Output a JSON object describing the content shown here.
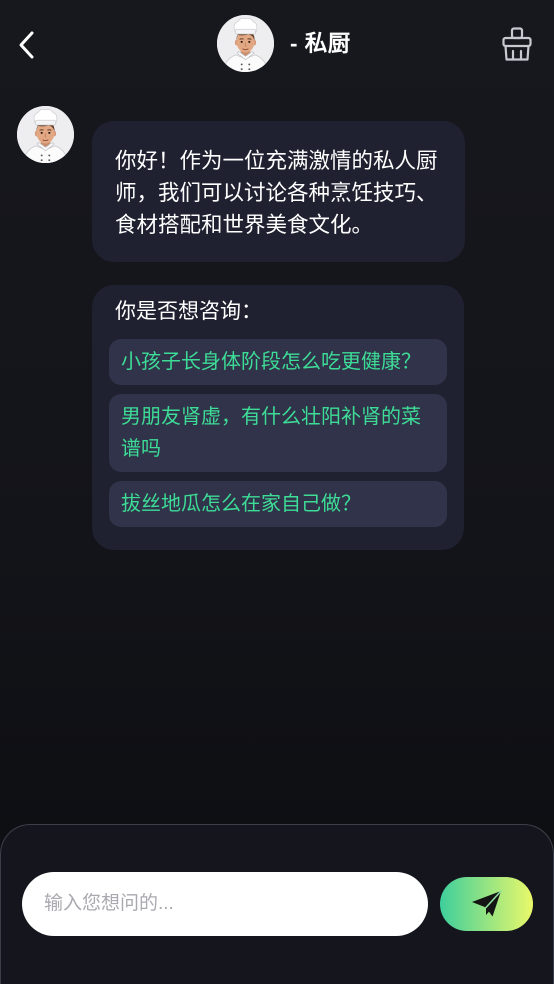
{
  "header": {
    "back_icon": "chevron-left-icon",
    "avatar": "chef-avatar",
    "title": "- 私厨",
    "clear_icon": "brush-icon"
  },
  "chat": {
    "bot_avatar": "chef-avatar",
    "greeting": "你好！作为一位充满激情的私人厨师，我们可以讨论各种烹饪技巧、食材搭配和世界美食文化。",
    "suggestions_title": "你是否想咨询：",
    "suggestions": [
      "小孩子长身体阶段怎么吃更健康？",
      "男朋友肾虚，有什么壮阳补肾的菜谱吗",
      "拔丝地瓜怎么在家自己做？"
    ]
  },
  "composer": {
    "placeholder": "输入您想问的...",
    "send_icon": "paper-plane-icon"
  },
  "theme": {
    "bg_top": "#17181e",
    "bg_bottom": "#0b0c10",
    "bubble": "#1f2130",
    "chip": "#303349",
    "chip_text": "#3ddc97",
    "send_from": "#3ecf9c",
    "send_to": "#eaf86a",
    "panel": "#15161d",
    "panel_border": "#3c3f4a"
  }
}
